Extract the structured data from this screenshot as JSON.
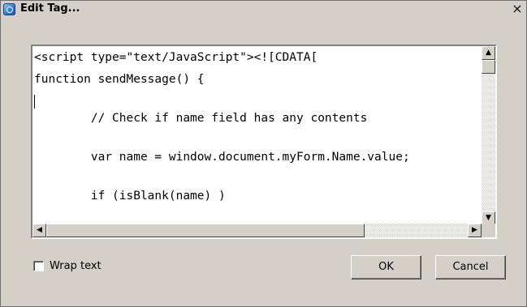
{
  "window": {
    "title": "Edit Tag...",
    "close_glyph": "×"
  },
  "editor": {
    "lines": [
      "<script type=\"text/JavaScript\"><![CDATA[",
      "function sendMessage() {",
      "",
      "        // Check if name field has any contents",
      "",
      "        var name = window.document.myForm.Name.value;",
      "",
      "        if (isBlank(name) )"
    ]
  },
  "scrollbars": {
    "up_arrow": "▲",
    "down_arrow": "▼",
    "left_arrow": "◀",
    "right_arrow": "▶"
  },
  "options": {
    "wrap_label": "Wrap text",
    "wrap_checked": false
  },
  "buttons": {
    "ok": "OK",
    "cancel": "Cancel"
  }
}
